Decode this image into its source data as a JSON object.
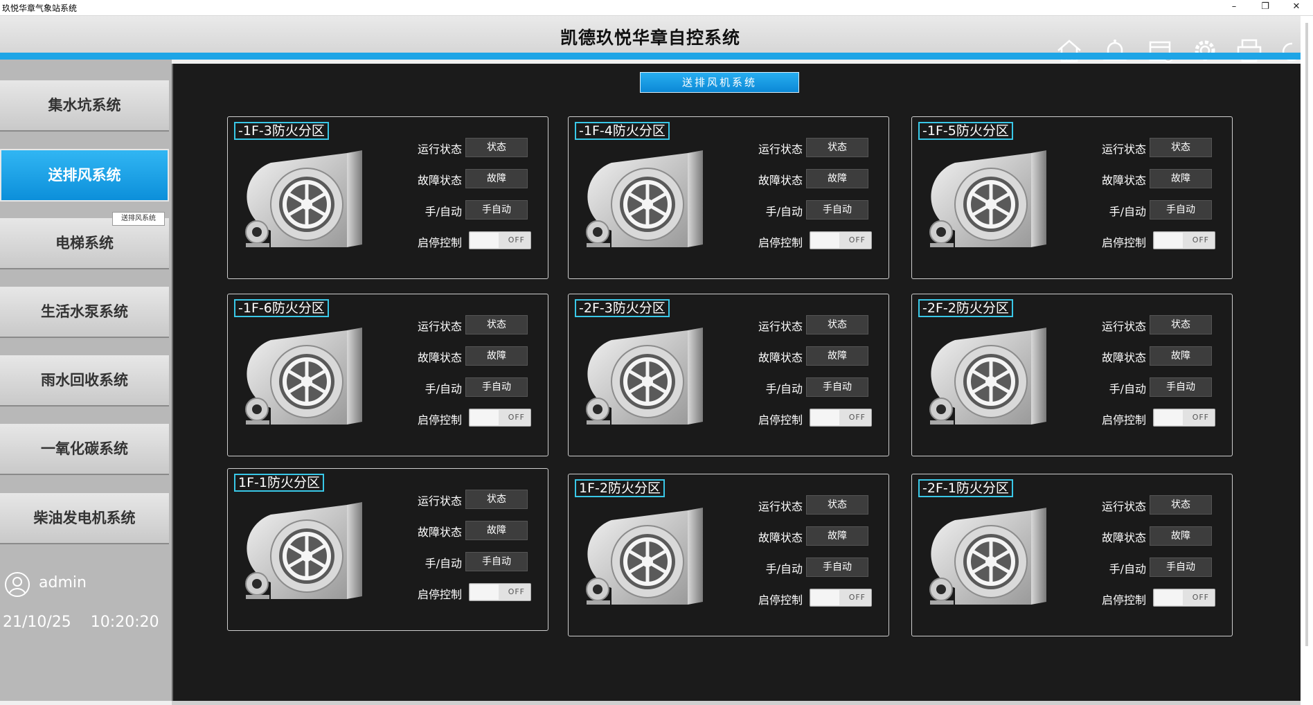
{
  "window": {
    "title": "玖悦华章气象站系统"
  },
  "header": {
    "title": "凯德玖悦华章自控系统"
  },
  "header_icons": [
    "home-icon",
    "bell-icon",
    "calendar-icon",
    "gear-icon",
    "printer-icon",
    "power-icon"
  ],
  "sidebar": {
    "items": [
      {
        "label": "集水坑系统"
      },
      {
        "label": "送排风系统",
        "active": true
      },
      {
        "label": "电梯系统"
      },
      {
        "label": "生活水泵系统"
      },
      {
        "label": "雨水回收系统"
      },
      {
        "label": "一氧化碳系统"
      },
      {
        "label": "柴油发电机系统"
      }
    ],
    "tooltip": "送排风系统",
    "user": "admin",
    "date": "21/10/25",
    "time": "10:20:20"
  },
  "main": {
    "subtitle": "送排风机系统",
    "labels": {
      "run": "运行状态",
      "fault": "故障状态",
      "mode": "手/自动",
      "control": "启停控制"
    },
    "buttons": {
      "run": "状态",
      "fault": "故障",
      "mode": "手自动",
      "toggle": "OFF"
    },
    "panels": [
      {
        "zone": "-1F-3防火分区"
      },
      {
        "zone": "-1F-4防火分区"
      },
      {
        "zone": "-1F-5防火分区"
      },
      {
        "zone": "-1F-6防火分区"
      },
      {
        "zone": "-2F-3防火分区"
      },
      {
        "zone": "-2F-2防火分区"
      },
      {
        "zone": "1F-1防火分区"
      },
      {
        "zone": "1F-2防火分区"
      },
      {
        "zone": " -2F-1防火分区"
      }
    ]
  },
  "colors": {
    "accent": "#1ea5e6",
    "zone_border": "#39c8e8",
    "panel_bg": "#1b1b1b"
  }
}
